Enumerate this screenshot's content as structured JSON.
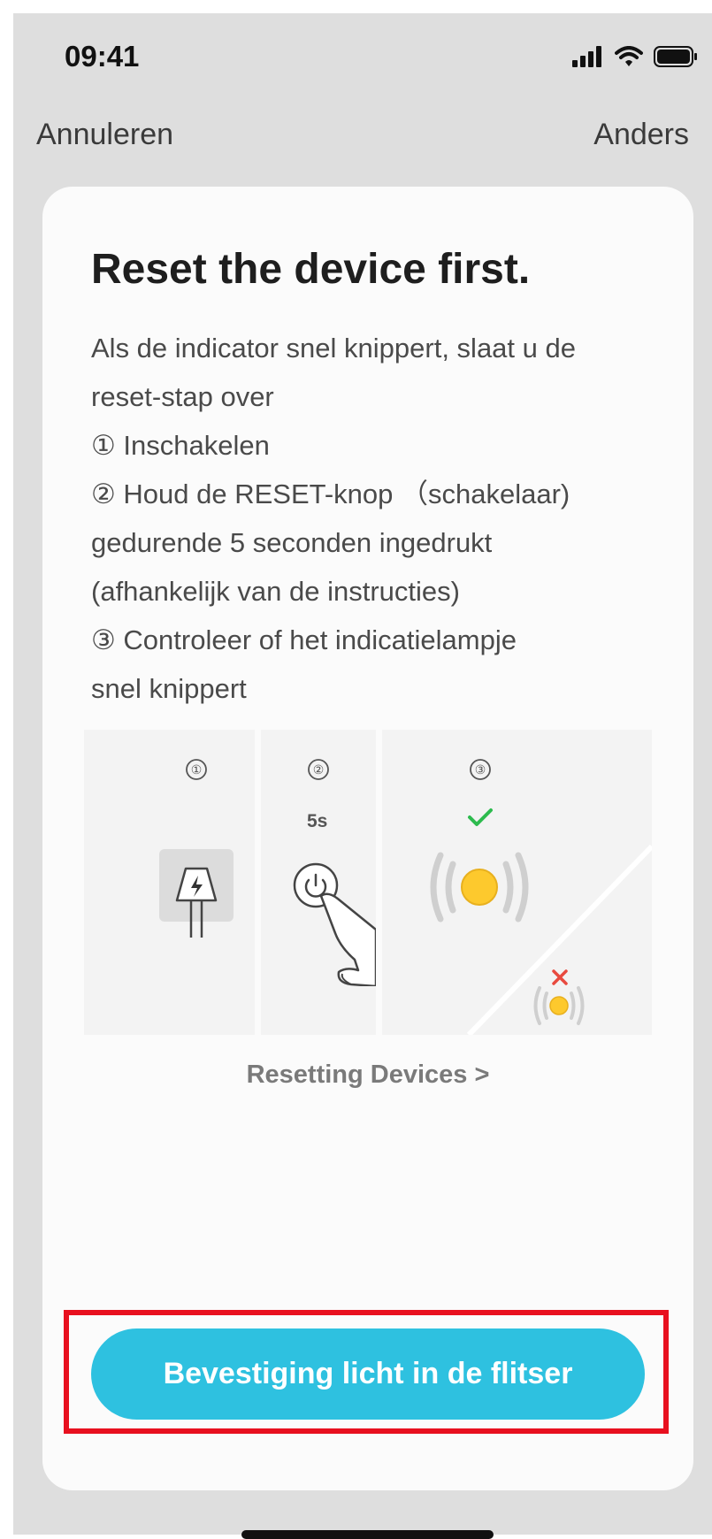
{
  "status_bar": {
    "time": "09:41"
  },
  "nav": {
    "cancel_label": "Annuleren",
    "other_label": "Anders"
  },
  "card": {
    "title": "Reset the device first.",
    "instruction_lines": [
      "Als de indicator snel knippert, slaat u de",
      "reset-stap over",
      "① Inschakelen",
      "② Houd de RESET-knop （schakelaar)",
      "gedurende 5 seconden ingedrukt",
      "(afhankelijk van de instructies)",
      "③ Controleer of het indicatielampje",
      "snel knippert"
    ],
    "illustration": {
      "steps": [
        "①",
        "②",
        "③"
      ],
      "press_duration": "5s",
      "icons": [
        "plug-power-icon",
        "power-button-icon",
        "pointing-hand-icon",
        "check-icon",
        "blinking-light-icon",
        "cross-icon",
        "slow-light-icon"
      ]
    },
    "reset_link": "Resetting Devices >",
    "confirm_button": "Bevestiging licht in de flitser"
  },
  "colors": {
    "accent": "#2ec1e0",
    "highlight": "#e8101f",
    "check": "#2dbb4e",
    "cross": "#e84a3f",
    "light": "#fdc92d"
  }
}
